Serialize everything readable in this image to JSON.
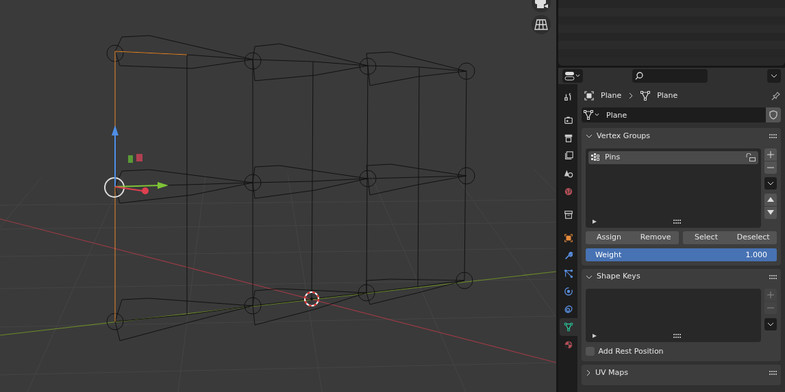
{
  "properties": {
    "tabs": [
      {
        "kind": "tool",
        "selected": false
      },
      {
        "kind": "render",
        "selected": false
      },
      {
        "kind": "output",
        "selected": false
      },
      {
        "kind": "view_layer",
        "selected": false
      },
      {
        "kind": "scene",
        "selected": false
      },
      {
        "kind": "world",
        "selected": false
      },
      {
        "kind": "collection",
        "selected": false
      },
      {
        "kind": "object",
        "selected": false
      },
      {
        "kind": "modifiers",
        "selected": false
      },
      {
        "kind": "particles",
        "selected": false
      },
      {
        "kind": "physics",
        "selected": false
      },
      {
        "kind": "constraints",
        "selected": false
      },
      {
        "kind": "data",
        "selected": true
      },
      {
        "kind": "material",
        "selected": false
      }
    ],
    "breadcrumb": [
      {
        "kind": "object",
        "label": "Plane"
      },
      {
        "kind": "mesh",
        "label": "Plane"
      }
    ],
    "data_block": {
      "name": "Plane"
    },
    "panels": [
      {
        "kind": "vertex_groups",
        "title": "Vertex Groups",
        "expanded": true,
        "items": [
          {
            "name": "Pins",
            "selected": true,
            "locked": false
          }
        ],
        "buttons": [
          "Assign",
          "Remove",
          "Select",
          "Deselect"
        ],
        "weight": {
          "label": "Weight",
          "value": "1.000",
          "level": 1.0
        }
      },
      {
        "kind": "shape_keys",
        "title": "Shape Keys",
        "expanded": true,
        "option": {
          "label": "Add Rest Position",
          "checked": false
        }
      },
      {
        "kind": "uv_maps",
        "title": "UV Maps",
        "expanded": false
      }
    ]
  }
}
